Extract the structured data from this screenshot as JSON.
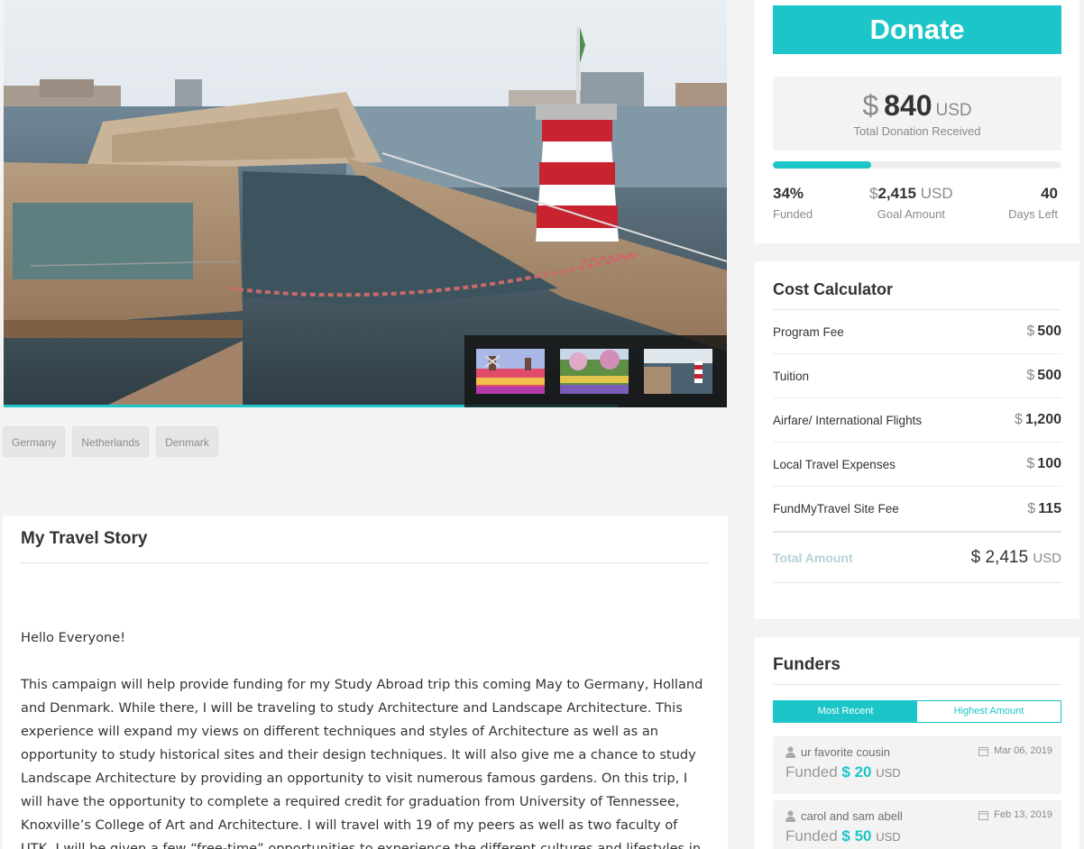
{
  "donate": {
    "button_label": "Donate",
    "currency_symbol": "$",
    "total_amount": "840",
    "total_unit": "USD",
    "total_label": "Total Donation Received",
    "funded_fraction": 0.34,
    "funded_percent": "34%",
    "funded_label": "Funded",
    "goal_symbol": "$",
    "goal_amount": "2,415",
    "goal_unit": "USD",
    "goal_label": "Goal Amount",
    "days_left": "40",
    "days_label": "Days Left"
  },
  "gallery": {
    "main_image": "copenhagen-harbour-bath-with-red-white-lighthouse",
    "thumbnails": [
      "tulip-fields-windmills",
      "garden-flowers",
      "harbour-bath-lighthouse"
    ],
    "slide_progress_fraction": 0.85
  },
  "tags": [
    "Germany",
    "Netherlands",
    "Denmark"
  ],
  "story": {
    "title": "My Travel Story",
    "greeting": "Hello Everyone!",
    "paragraph": "This campaign will help provide funding for my Study Abroad trip this coming May to Germany, Holland and Denmark. While there, I will be traveling to study Architecture and Landscape Architecture. This experience will expand my views on different techniques and styles of Architecture as well as an opportunity to study historical sites and their design techniques. It will also give me a chance to study Landscape Architecture by providing an opportunity to visit numerous famous gardens. On this trip, I will have the opportunity to complete a required credit for graduation from University of Tennessee, Knoxville’s College of Art and Architecture. I will travel with 19 of my peers as well as two faculty of UTK. I will be given a few “free-time” opportunities to experience the different cultures and lifestyles in Germany, Holland and Denmark. This trip is"
  },
  "calculator": {
    "title": "Cost Calculator",
    "currency_symbol": "$",
    "items": [
      {
        "name": "Program Fee",
        "value": "500"
      },
      {
        "name": "Tuition",
        "value": "500"
      },
      {
        "name": "Airfare/ International Flights",
        "value": "1,200"
      },
      {
        "name": "Local Travel Expenses",
        "value": "100"
      },
      {
        "name": "FundMyTravel Site Fee",
        "value": "115"
      }
    ],
    "total_label": "Total Amount",
    "total_value": "$ 2,415",
    "total_unit": "USD"
  },
  "funders": {
    "title": "Funders",
    "tabs": [
      "Most Recent",
      "Highest Amount"
    ],
    "active_tab": "Most Recent",
    "list": [
      {
        "name": "ur favorite cousin",
        "date": "Mar 06, 2019",
        "funded_label": "Funded",
        "amount": "$ 20",
        "unit": "USD"
      },
      {
        "name": "carol and sam abell",
        "date": "Feb 13, 2019",
        "funded_label": "Funded",
        "amount": "$ 50",
        "unit": "USD"
      }
    ]
  },
  "colors": {
    "accent": "#1cc5c7",
    "background": "#f3f3f3",
    "text": "#333333",
    "muted": "#8a8a8a"
  }
}
